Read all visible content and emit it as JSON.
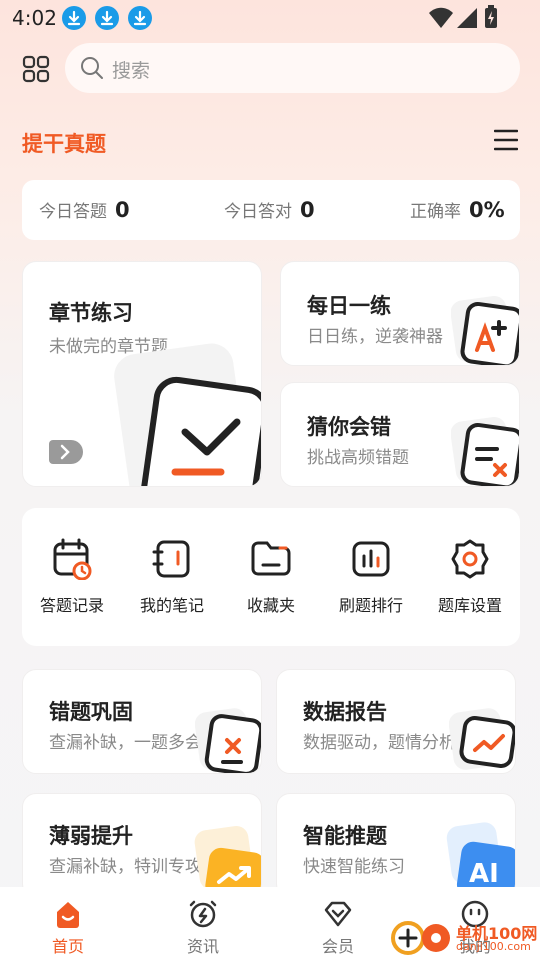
{
  "status_bar": {
    "time": "4:02"
  },
  "search": {
    "placeholder": "搜索"
  },
  "page": {
    "title": "提干真题"
  },
  "stats": [
    {
      "label": "今日答题",
      "value": "0"
    },
    {
      "label": "今日答对",
      "value": "0"
    },
    {
      "label": "正确率",
      "value": "0%"
    }
  ],
  "feature_cards": {
    "chapter": {
      "title": "章节练习",
      "subtitle": "未做完的章节题"
    },
    "daily": {
      "title": "每日一练",
      "subtitle": "日日练，逆袭神器"
    },
    "guess": {
      "title": "猜你会错",
      "subtitle": "挑战高频错题"
    }
  },
  "tools": [
    {
      "label": "答题记录",
      "icon": "calendar-clock-icon"
    },
    {
      "label": "我的笔记",
      "icon": "notebook-icon"
    },
    {
      "label": "收藏夹",
      "icon": "folder-icon"
    },
    {
      "label": "刷题排行",
      "icon": "bar-chart-icon"
    },
    {
      "label": "题库设置",
      "icon": "gear-icon"
    }
  ],
  "module_cards": [
    {
      "title": "错题巩固",
      "subtitle": "查漏补缺，一题多会"
    },
    {
      "title": "数据报告",
      "subtitle": "数据驱动，题情分析"
    },
    {
      "title": "薄弱提升",
      "subtitle": "查漏补缺，特训专攻"
    },
    {
      "title": "智能推题",
      "subtitle": "快速智能练习",
      "badge": "AI"
    }
  ],
  "bottom_nav": [
    {
      "label": "首页",
      "icon": "home-icon",
      "active": true
    },
    {
      "label": "资讯",
      "icon": "news-icon",
      "active": false
    },
    {
      "label": "会员",
      "icon": "diamond-icon",
      "active": false
    },
    {
      "label": "我的",
      "icon": "profile-icon",
      "active": false
    }
  ],
  "watermark": {
    "text": "单机100网",
    "url": "danji100.com"
  },
  "colors": {
    "accent": "#f05a24",
    "download_badge": "#1a9be8"
  }
}
